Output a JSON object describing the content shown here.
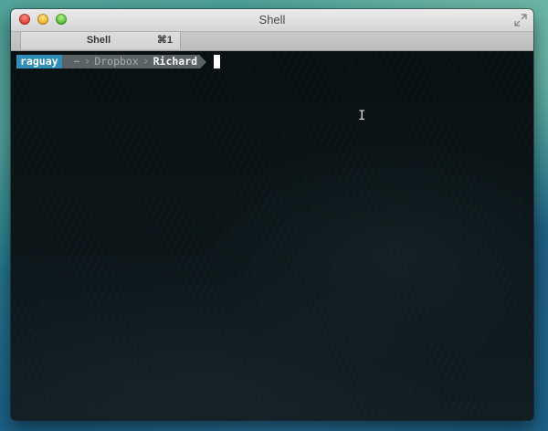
{
  "window": {
    "title": "Shell"
  },
  "tabs": [
    {
      "label": "Shell",
      "shortcut": "⌘1"
    }
  ],
  "prompt": {
    "user": "raguay",
    "path": [
      "~",
      "Dropbox",
      "Richard"
    ]
  },
  "icons": {
    "close": "close-icon",
    "minimize": "minimize-icon",
    "zoom": "zoom-icon",
    "fullscreen": "fullscreen-icon",
    "separator": "chevron-right-icon",
    "text_cursor": "ibeam-cursor-icon"
  },
  "colors": {
    "prompt_user_bg": "#2f8fb8",
    "prompt_path_bg": "#5a6266",
    "terminal_bg": "#0b1214"
  }
}
